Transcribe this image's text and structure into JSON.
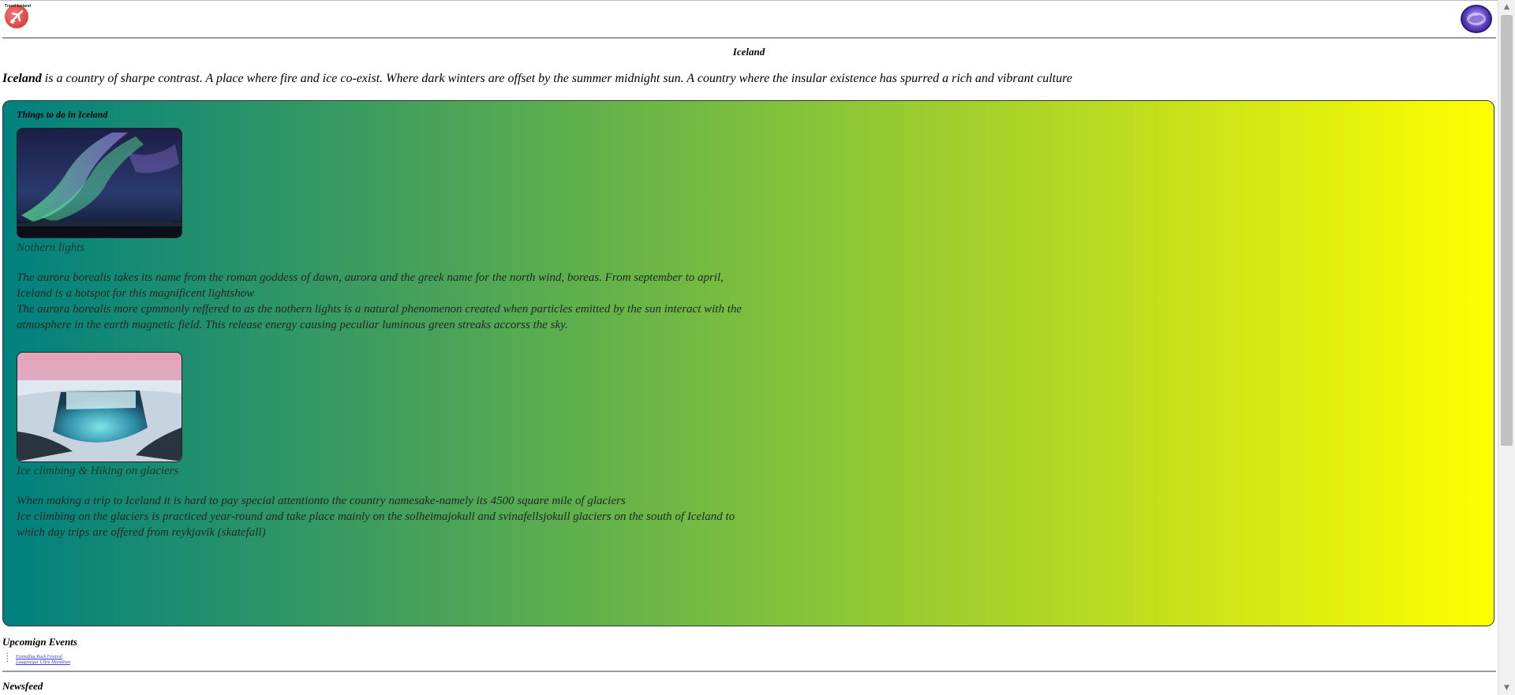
{
  "header": {
    "logo_left_text": "Travel Iceland",
    "title": "Iceland"
  },
  "intro": {
    "lead": "Iceland",
    "text": " is a country of sharpe contrast. A place where fire and ice co-exist. Where dark winters are offset by the summer midnight sun. A country where the insular existence has spurred a rich and vibrant culture"
  },
  "things_to_do": {
    "heading": "Things to do in Iceland",
    "items": [
      {
        "title": "Nothern lights",
        "image_icon": "northern-lights-photo",
        "paragraphs": [
          "The aurora borealis takes its name from the roman goddess of dawn, aurora and the greek name for the north wind, boreas. From september to april, Iceland is a hotspot for this magnificent lightshow",
          "The aurora borealis more cpmmonly reffered to as the nothern lights is a natural phenomenon created when particles emitted by the sun interact with the atmosphere in the earth magnetic field. This release energy causing peculiar luminous green streaks accorss the sky."
        ]
      },
      {
        "title": "Ice climbing & Hiking on glaciers",
        "image_icon": "glacier-waterfall-photo",
        "paragraphs": [
          "When making a trip to Iceland it is hard to pay special attentionto the country namesake-namely its 4500 square mile of glaciers",
          "Ice climbing on the glaciers is practiced year-round and take place mainly on the solheimajokull and svinafellsjokull glaciers on the south of Iceland to which day trips are offered from reykjavik (skatefall)"
        ]
      }
    ]
  },
  "events": {
    "heading": "Upcomign Events",
    "items": [
      "Eistnaflug Rock Festival",
      "Laugavegur Ultra Marathon"
    ]
  },
  "newsfeed": {
    "heading": "Newsfeed"
  },
  "colors": {
    "panel_gradient_start": "#008080",
    "panel_gradient_end": "#ffff00",
    "link": "#3b3bd6"
  }
}
